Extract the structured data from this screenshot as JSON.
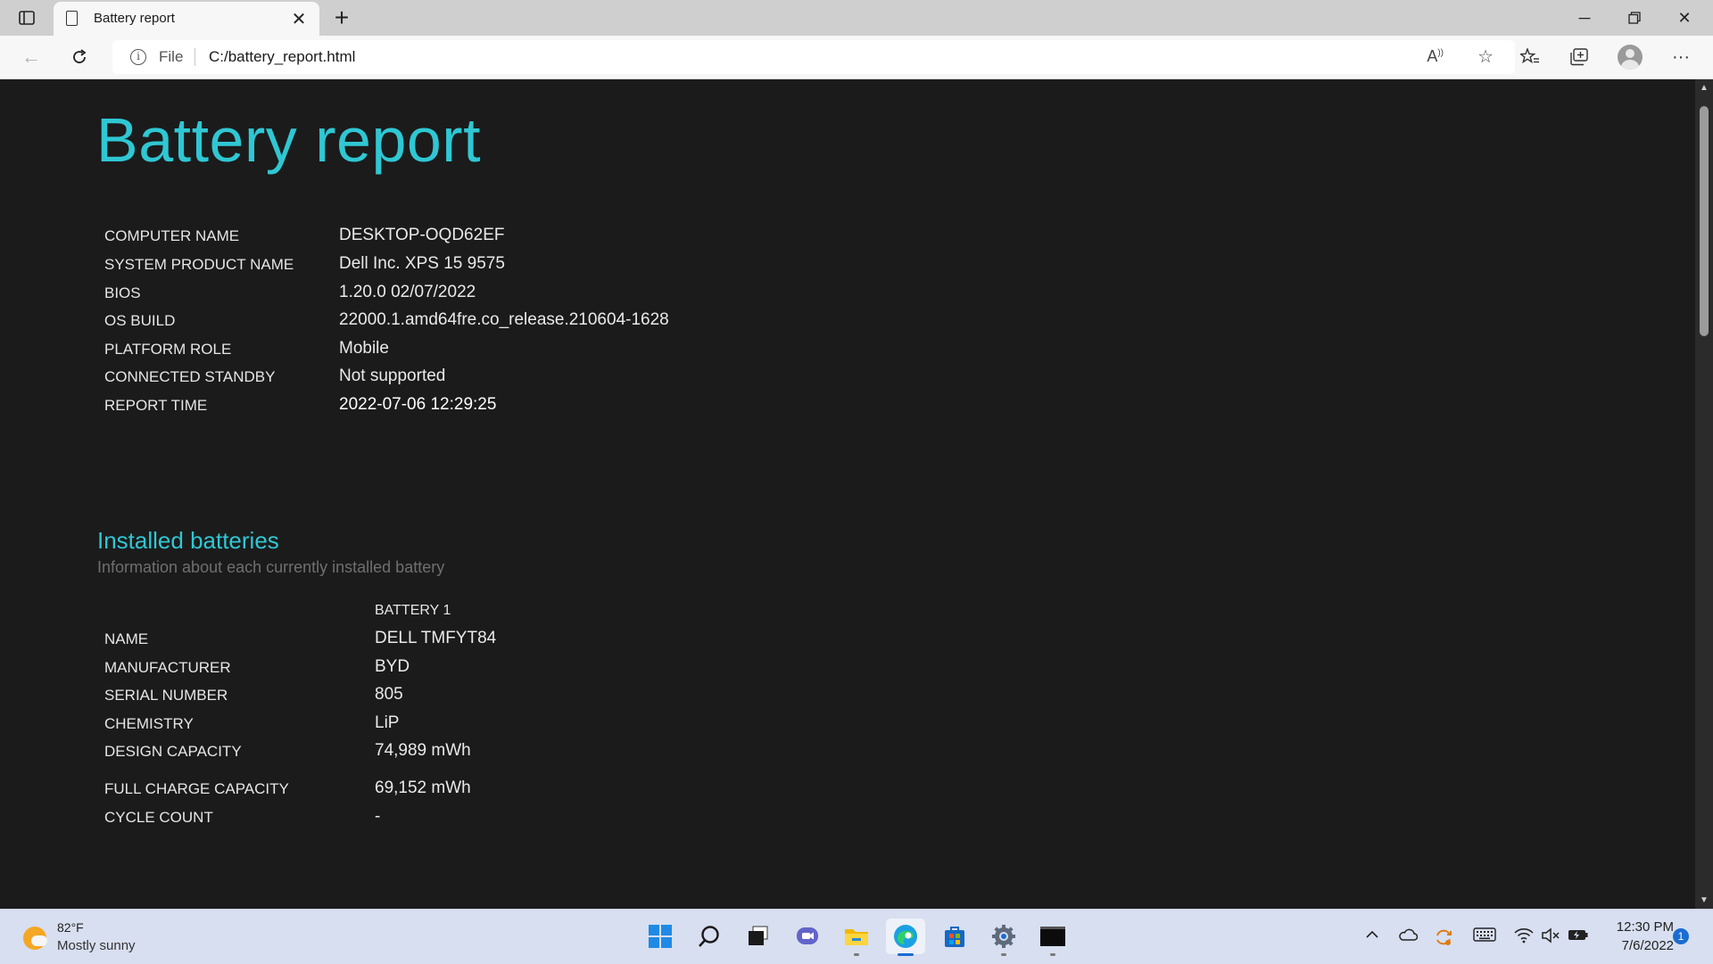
{
  "browser": {
    "tab_title": "Battery report",
    "address_scheme": "File",
    "address_url": "C:/battery_report.html",
    "accent_color": "#2fc7d3"
  },
  "report": {
    "title": "Battery report",
    "system_info": [
      {
        "key": "COMPUTER NAME",
        "value": "DESKTOP-OQD62EF"
      },
      {
        "key": "SYSTEM PRODUCT NAME",
        "value": "Dell Inc. XPS 15 9575"
      },
      {
        "key": "BIOS",
        "value": "1.20.0 02/07/2022"
      },
      {
        "key": "OS BUILD",
        "value": "22000.1.amd64fre.co_release.210604-1628"
      },
      {
        "key": "PLATFORM ROLE",
        "value": "Mobile"
      },
      {
        "key": "CONNECTED STANDBY",
        "value": "Not supported"
      },
      {
        "key": "REPORT TIME",
        "value": "2022-07-06  12:29:25"
      }
    ],
    "installed_batteries": {
      "title": "Installed batteries",
      "subtitle": "Information about each currently installed battery",
      "column_header": "BATTERY 1",
      "rows": [
        {
          "key": "NAME",
          "value": "DELL TMFYT84"
        },
        {
          "key": "MANUFACTURER",
          "value": "BYD"
        },
        {
          "key": "SERIAL NUMBER",
          "value": "805"
        },
        {
          "key": "CHEMISTRY",
          "value": "LiP"
        },
        {
          "key": "DESIGN CAPACITY",
          "value": "74,989 mWh"
        },
        {
          "key": "FULL CHARGE CAPACITY",
          "value": "69,152 mWh"
        },
        {
          "key": "CYCLE COUNT",
          "value": "-"
        }
      ]
    }
  },
  "taskbar": {
    "weather_temp": "82°F",
    "weather_desc": "Mostly sunny",
    "time": "12:30 PM",
    "date": "7/6/2022",
    "notification_count": "1",
    "apps": [
      "start-icon",
      "search-icon",
      "task-view-icon",
      "chat-icon",
      "file-explorer-icon",
      "edge-icon",
      "store-icon",
      "settings-icon",
      "terminal-icon"
    ]
  }
}
